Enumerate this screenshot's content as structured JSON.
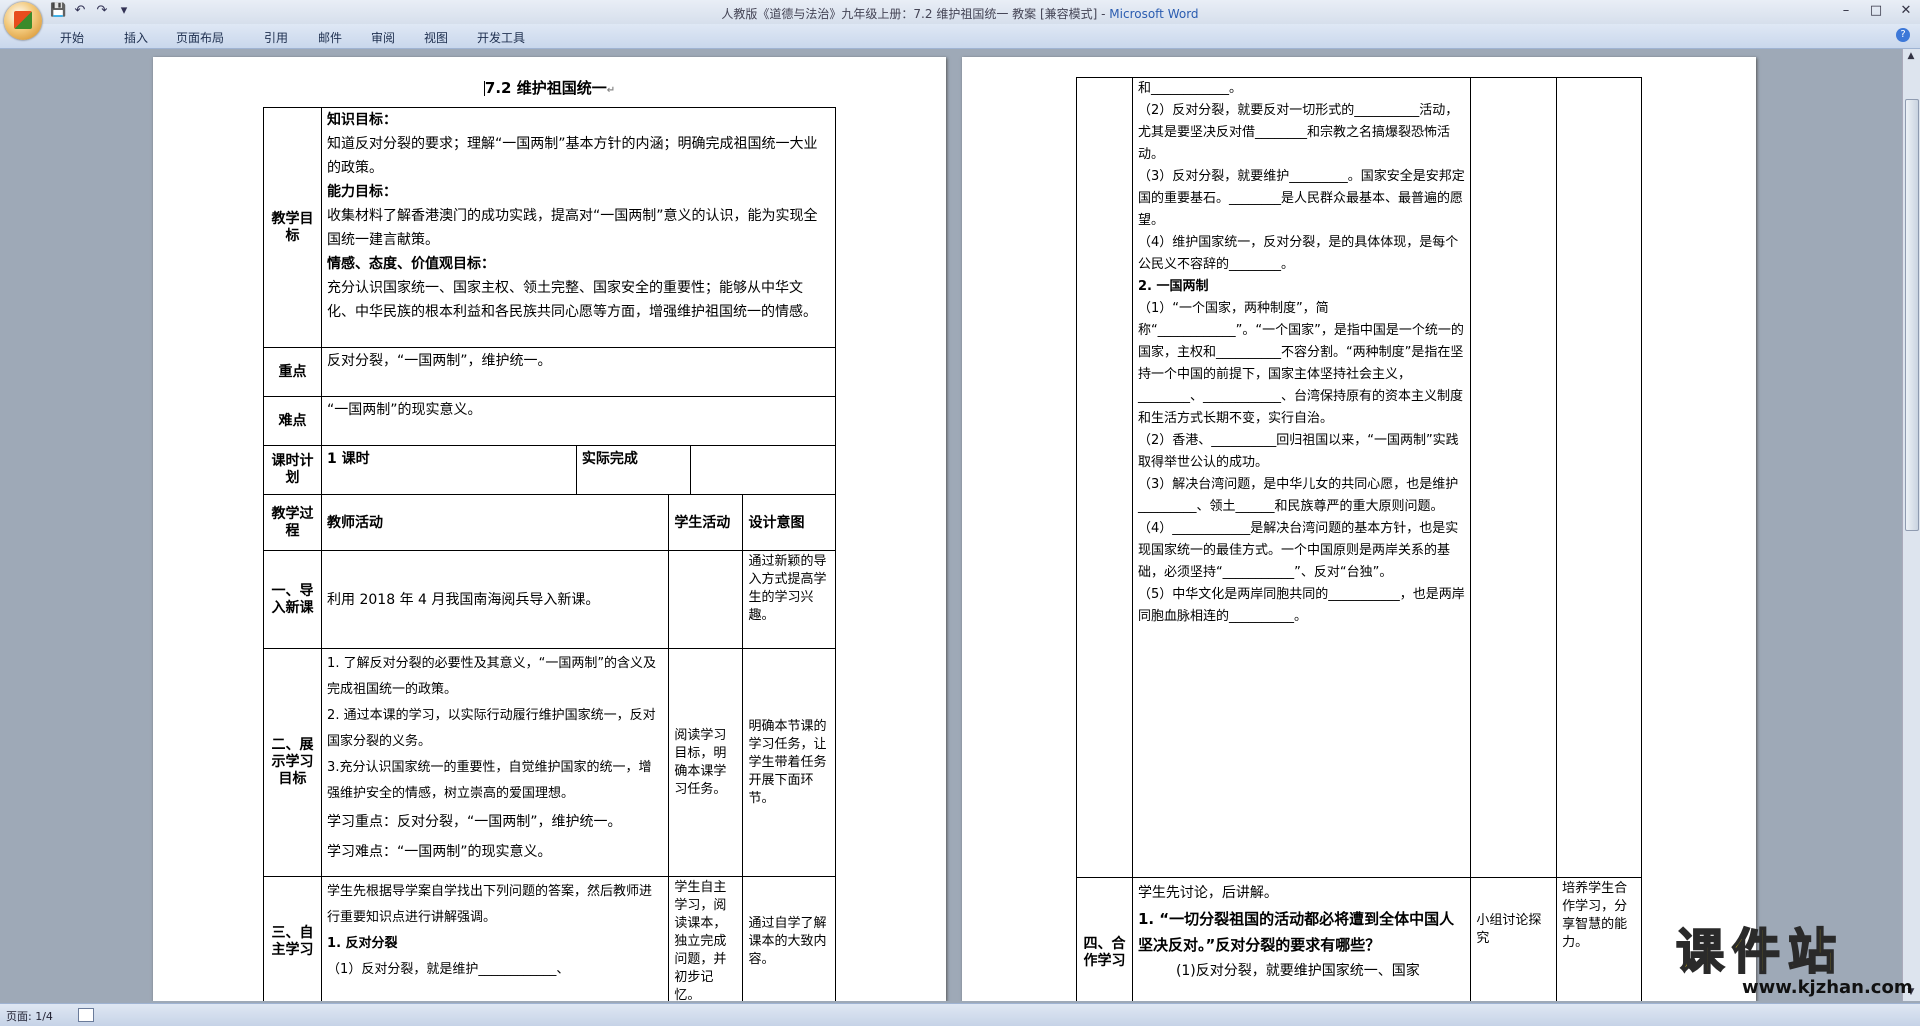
{
  "window": {
    "title_doc": "人教版《道德与法治》九年级上册：7.2 维护祖国统一 教案 [兼容模式] - ",
    "title_app": "Microsoft Word"
  },
  "ribbon": {
    "tabs": [
      "开始",
      "插入",
      "页面布局",
      "引用",
      "邮件",
      "审阅",
      "视图",
      "开发工具"
    ]
  },
  "statusbar": {
    "page": "页面: 1/4"
  },
  "page1": {
    "heading": "7.2 维护祖国统一",
    "objectives_label": "教学目标",
    "knowledge_title": "知识目标：",
    "knowledge_text": "知道反对分裂的要求；理解“一国两制”基本方针的内涵；明确完成祖国统一大业的政策。",
    "ability_title": "能力目标：",
    "ability_text": "收集材料了解香港澳门的成功实践，提高对“一国两制”意义的认识，能为实现全国统一建言献策。",
    "emotion_title": "情感、态度、价值观目标：",
    "emotion_text": "充分认识国家统一、国家主权、领土完整、国家安全的重要性；能够从中华文化、中华民族的根本利益和各民族共同心愿等方面，增强维护祖国统一的情感。",
    "key_label": "重点",
    "key_text": "反对分裂，“一国两制”，维护统一。",
    "diff_label": "难点",
    "diff_text": "“一国两制”的现实意义。",
    "hours_label": "课时计划",
    "hours_value": "1 课时",
    "actual_label": "实际完成",
    "process_label": "教学过程",
    "col_teacher": "教师活动",
    "col_student": "学生活动",
    "col_design": "设计意图",
    "s1_label": "一、导入新课",
    "s1_teacher": "利用 2018 年 4 月我国南海阅兵导入新课。",
    "s1_design": "通过新颖的导入方式提高学生的学习兴趣。",
    "s2_label": "二、展示学习目标",
    "s2_t1": "1. 了解反对分裂的必要性及其意义，“一国两制”的含义及完成祖国统一的政策。",
    "s2_t2": "2. 通过本课的学习，以实际行动履行维护国家统一，反对国家分裂的义务。",
    "s2_t3": "3.充分认识国家统一的重要性，自觉维护国家的统一，增强维护安全的情感，树立崇高的爱国理想。",
    "s2_key": "学习重点：反对分裂，“一国两制”，维护统一。",
    "s2_diff": "学习难点：“一国两制”的现实意义。",
    "s2_student": "阅读学习目标，明确本课学习任务。",
    "s2_design": "明确本节课的学习任务，让学生带着任务开展下面环节。",
    "s3_label": "三、自主学习",
    "s3_t1": "学生先根据导学案自学找出下列问题的答案，然后教师进行重要知识点进行讲解强调。",
    "s3_t2": "1. 反对分裂",
    "s3_t3": "（1）反对分裂，就是维护____________、",
    "s3_student": "学生自主学习，阅读课本，独立完成问题，并初步记忆。",
    "s3_design": "通过自学了解课本的大致内容。"
  },
  "page2": {
    "lines": [
      "和____________。",
      "（2）反对分裂，就要反对一切形式的__________活动，尤其是要坚决反对借________和宗教之名搞爆裂恐怖活动。",
      "（3）反对分裂，就要维护_________。国家安全是安邦定国的重要基石。________是人民群众最基本、最普遍的愿望。",
      "（4）维护国家统一，反对分裂，是的具体体现，是每个公民义不容辞的________。",
      "2. 一国两制",
      "（1）“一个国家，两种制度”，简称“____________”。“一个国家”，是指中国是一个统一的国家，主权和__________不容分割。“两种制度”是指在坚持一个中国的前提下，国家主体坚持社会主义，________、____________、台湾保持原有的资本主义制度和生活方式长期不变，实行自治。",
      "（2）香港、__________回归祖国以来，“一国两制”实践取得举世公认的成功。",
      "（3）解决台湾问题，是中华儿女的共同心愿，也是维护_________、领土______和民族尊严的重大原则问题。",
      "（4）____________是解决台湾问题的基本方针，也是实现国家统一的最佳方式。一个中国原则是两岸关系的基础，必须坚持“___________”、反对“台独”。",
      "（5）中华文化是两岸同胞共同的___________，也是两岸同胞血脉相连的__________。"
    ],
    "s4_label": "四、合作学习",
    "s4_t1": "学生先讨论，后讲解。",
    "s4_t2": "1. “一切分裂祖国的活动都必将遭到全体中国人坚决反对。”反对分裂的要求有哪些？",
    "s4_t3": "(1)反对分裂，就要维护国家统一、国家",
    "s4_student": "小组讨论探究",
    "s4_design": "培养学生合作学习，分享智慧的能力。"
  },
  "watermark": {
    "text": "课件站",
    "url": "www.kjzhan.com"
  }
}
